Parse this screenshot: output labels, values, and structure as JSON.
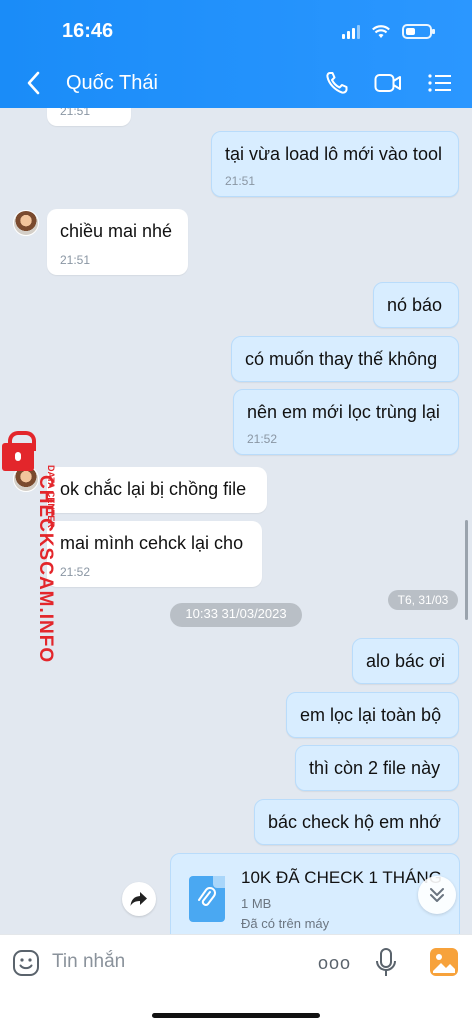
{
  "status_bar": {
    "time": "16:46"
  },
  "header": {
    "contact_name": "Quốc Thái"
  },
  "messages": [
    {
      "time": "21:51"
    },
    {
      "text": "tại vừa load lô mới vào tool",
      "time": "21:51"
    },
    {
      "text": "chiều mai nhé",
      "time": "21:51"
    },
    {
      "text": "nó báo"
    },
    {
      "text": "có muốn thay thế không"
    },
    {
      "text": "nên em mới lọc trùng lại",
      "time": "21:52"
    },
    {
      "text": "ok chắc lại bị chồng file"
    },
    {
      "text": "mai mình cehck lại cho",
      "time": "21:52"
    },
    {
      "text": "alo bác ơi"
    },
    {
      "text": "em lọc lại toàn bộ"
    },
    {
      "text": "thì còn 2 file này"
    },
    {
      "text": "bác check hộ em nhớ"
    }
  ],
  "date_separator": "10:33 31/03/2023",
  "date_badge": "T6, 31/03",
  "file": {
    "name": "10K  ĐÃ CHECK 1 THÁNG",
    "size": "1 MB",
    "status": "Đã có trên máy"
  },
  "watermark": {
    "text": "CHECKSCAM.INFO",
    "subtext": "DATA CENTER"
  },
  "input": {
    "placeholder": "Tin nhắn",
    "more": "ooo"
  },
  "colors": {
    "header": "#1a8cf8",
    "outgoing_bubble": "#d8edff",
    "watermark": "#e3262b"
  }
}
